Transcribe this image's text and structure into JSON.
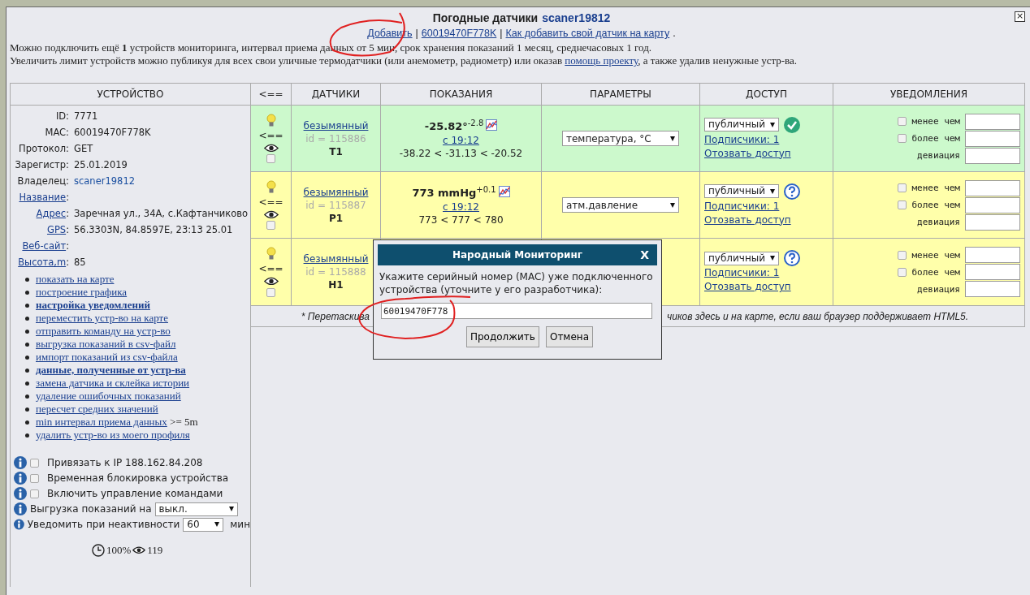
{
  "window": {
    "title": "Погодные датчики",
    "owner": "scaner19812",
    "close": "×"
  },
  "links": [
    {
      "text": "Добавить",
      "after": "|"
    },
    {
      "text": "60019470F778K",
      "after": "|"
    },
    {
      "text": "Как добавить свой датчик на карту",
      "after": "."
    }
  ],
  "info": [
    "Можно подключить ещё **1** устройств мониторинга, интервал приема данных от 5 мин, срок хранения показаний 1 месяц, среднечасовых 1 год."
  ],
  "limit": {
    "before": "Увеличить лимит устройств можно публикуя для всех свои уличные термодатчики (или анемометр, радиометр) или оказав",
    "link": "помощь проекту",
    "after": ", а также удалив ненужные устр-ва."
  },
  "table": {
    "columns": [
      "УСТРОЙСТВО",
      "<==",
      "ДАТЧИКИ",
      "ПОКАЗАНИЯ",
      "ПАРАМЕТРЫ",
      "ДОСТУП",
      "УВЕДОМЛЕНИЯ"
    ],
    "device": {
      "fields": [
        {
          "label": "ID:",
          "value": "7771"
        },
        {
          "label": "MAC:",
          "value": "60019470F778K"
        },
        {
          "label": "Протокол:",
          "value": "GET"
        },
        {
          "label": "Зарегистр:",
          "value": "25.01.2019"
        },
        {
          "label": "Владелец:",
          "value": "scaner19812",
          "value_link": true
        },
        {
          "label": "Название",
          "link": true,
          "suffix": ":"
        },
        {
          "label": "Адрес",
          "link": true,
          "suffix": ":",
          "value": "Заречная ул., 34А, с.Кафтанчиково"
        },
        {
          "label": "GPS",
          "link": true,
          "suffix": ":",
          "value": "56.3303N, 84.8597E, 23:13 25.01"
        },
        {
          "label": "Веб-сайт",
          "link": true,
          "suffix": ":"
        },
        {
          "label": "Высота,m",
          "link": true,
          "suffix": ":",
          "value": "85"
        }
      ],
      "actions": [
        {
          "text": "показать на карте",
          "bold": false
        },
        {
          "text": "построение графика",
          "bold": false
        },
        {
          "text": "настройка уведомлений",
          "bold": true
        },
        {
          "text": "переместить устр-во на карте",
          "bold": false
        },
        {
          "text": "отправить команду на устр-во",
          "bold": false
        },
        {
          "text": "выгрузка показаний в csv-файл",
          "bold": false
        },
        {
          "text": "импорт показаний из csv-файла",
          "bold": false
        },
        {
          "text": "данные, полученные от устр-ва",
          "bold": true
        },
        {
          "text": "замена датчика и склейка истории",
          "bold": false
        },
        {
          "text": "удаление ошибочных показаний",
          "bold": false
        },
        {
          "text": "пересчет средних значений",
          "bold": false
        },
        {
          "text": "min интервал приема данных",
          "bold": false,
          "suffix": ">= 5m"
        },
        {
          "text": "удалить устр-во из моего профиля",
          "bold": false
        }
      ],
      "options": [
        {
          "kind": "checkbox",
          "label": "Привязать к IP 188.162.84.208",
          "checked": false
        },
        {
          "kind": "checkbox",
          "label": "Временная блокировка устройства",
          "checked": false
        },
        {
          "kind": "checkbox",
          "label": "Включить управление командами",
          "checked": false
        },
        {
          "kind": "select",
          "label": "Выгрузка показаний на",
          "value": "выкл."
        },
        {
          "kind": "select",
          "label": "Уведомить при неактивности",
          "value": "60",
          "unit": "мин"
        }
      ],
      "stats": {
        "uptime": "100%",
        "views": "119"
      }
    },
    "rows": [
      {
        "color": "#ccf9cc",
        "arrow": "<==",
        "checked": false,
        "name": "безымянный",
        "id": "id = 115886",
        "code": "T1",
        "reading": {
          "value": "-25.82°$^{-2.8}$",
          "since": "с 19:12",
          "range": "-38.22 < -31.13 < -20.52"
        },
        "parameter": "температура, °C",
        "access": "публичный",
        "verified": true,
        "subscribers": "Подписчики: 1",
        "revoke": "Отозвать доступ",
        "alerts": [
          {
            "label": "менее чем",
            "checked": false
          },
          {
            "label": "более чем",
            "checked": false
          },
          {
            "label": "девиация"
          }
        ]
      },
      {
        "color": "#ffffaa",
        "arrow": "<==",
        "checked": false,
        "name": "безымянный",
        "id": "id = 115887",
        "code": "P1",
        "reading": {
          "value": "773 mmHg$^{+0.1}$",
          "since": "с 19:12",
          "range": "773 < 777 < 780"
        },
        "parameter": "атм.давление",
        "access": "публичный",
        "verified": false,
        "subscribers": "Подписчики: 1",
        "revoke": "Отозвать доступ",
        "alerts": [
          {
            "label": "менее чем",
            "checked": false
          },
          {
            "label": "более чем",
            "checked": false
          },
          {
            "label": "девиация"
          }
        ]
      },
      {
        "color": "#ffffaa",
        "arrow": "<==",
        "checked": false,
        "name": "безымянный",
        "id": "id = 115888",
        "code": "H1",
        "access": "публичный",
        "verified": false,
        "subscribers": "Подписчики: 1",
        "revoke": "Отозвать доступ",
        "alerts": [
          {
            "label": "менее чем",
            "checked": false
          },
          {
            "label": "более чем",
            "checked": false
          },
          {
            "label": "девиация"
          }
        ]
      }
    ],
    "footnote": [
      "* Перетаскива",
      "чиков здесь и на карте, если ваш браузер поддерживает HTML5."
    ]
  },
  "dialog": {
    "title": "Народный Мониторинг",
    "close": "X",
    "prompt": "Укажите серийный номер (MAC) уже подключенного устройства (уточните у его разработчика):",
    "value": "60019470F778",
    "buttons": [
      "Продолжить",
      "Отмена"
    ]
  }
}
